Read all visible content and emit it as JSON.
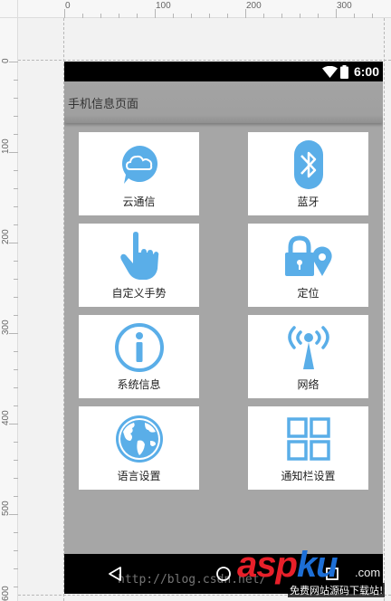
{
  "ruler": {
    "top_labels": [
      "0",
      "100",
      "200",
      "300"
    ],
    "left_labels": [
      "0",
      "100",
      "200",
      "300",
      "400",
      "500",
      "600"
    ]
  },
  "status_bar": {
    "time": "6:00",
    "icons": [
      "wifi-icon",
      "battery-icon"
    ]
  },
  "app_bar": {
    "title": "手机信息页面"
  },
  "tiles": [
    {
      "label": "云通信",
      "icon": "cloud-chat-icon"
    },
    {
      "label": "蓝牙",
      "icon": "bluetooth-icon"
    },
    {
      "label": "自定义手势",
      "icon": "hand-gesture-icon"
    },
    {
      "label": "定位",
      "icon": "lock-location-icon"
    },
    {
      "label": "系统信息",
      "icon": "info-icon"
    },
    {
      "label": "网络",
      "icon": "network-antenna-icon"
    },
    {
      "label": "语言设置",
      "icon": "globe-icon"
    },
    {
      "label": "通知栏设置",
      "icon": "grid-icon"
    }
  ],
  "nav_bar": {
    "buttons": [
      "back-icon",
      "home-icon",
      "recents-icon"
    ]
  },
  "watermark": {
    "url": "http://blog.csdn.net/",
    "logo_part1": "asp",
    "logo_part2": "ku",
    "logo_suffix": ".com",
    "subtitle": "免费网站源码下载站!"
  },
  "colors": {
    "icon_blue": "#5aaee8",
    "tile_bg": "#ffffff",
    "screen_bg": "#a6a6a6",
    "bars": "#000000"
  }
}
